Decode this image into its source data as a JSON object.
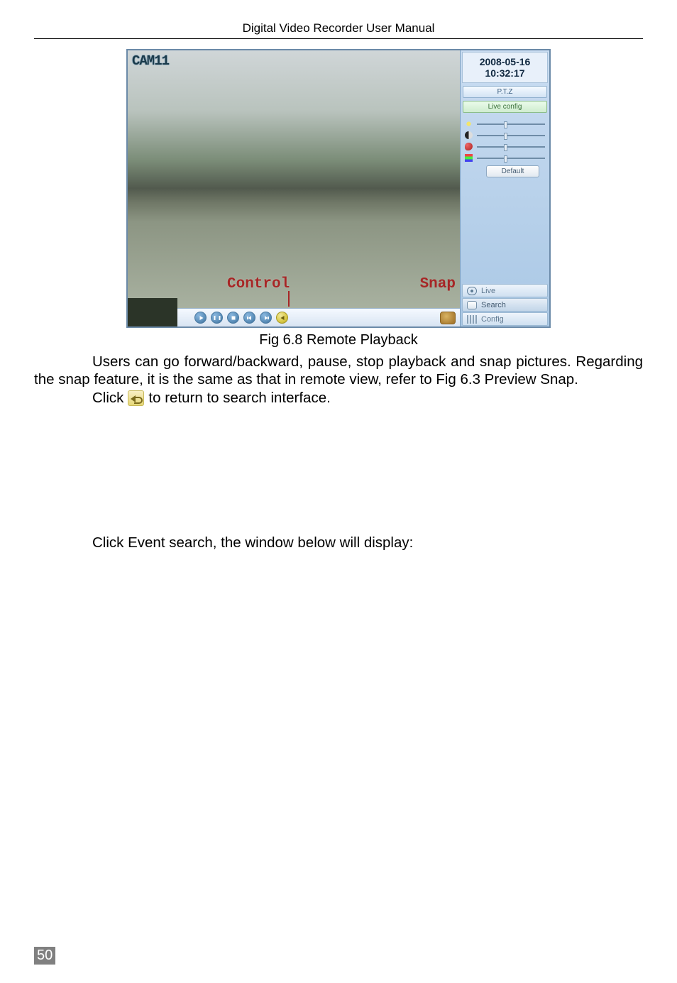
{
  "header": {
    "title": "Digital Video Recorder User Manual"
  },
  "screenshot": {
    "camera_label": "CAM11",
    "control_label": "Control",
    "snap_label": "Snap",
    "side": {
      "date": "2008-05-16",
      "time": "10:32:17",
      "tab_ptz": "P.T.Z",
      "tab_liveconfig": "Live config",
      "default_btn": "Default",
      "mode_live": "Live",
      "mode_search": "Search",
      "mode_config": "Config"
    }
  },
  "caption": "Fig 6.8    Remote Playback",
  "para1": "Users can go forward/backward, pause, stop playback and snap pictures. Regarding the snap feature, it is the same as that in remote view, refer to Fig 6.3 Preview Snap.",
  "click_pre": "Click",
  "click_post": "to return to search interface.",
  "para2": "Click Event search, the window below will display:",
  "page_number": "50"
}
